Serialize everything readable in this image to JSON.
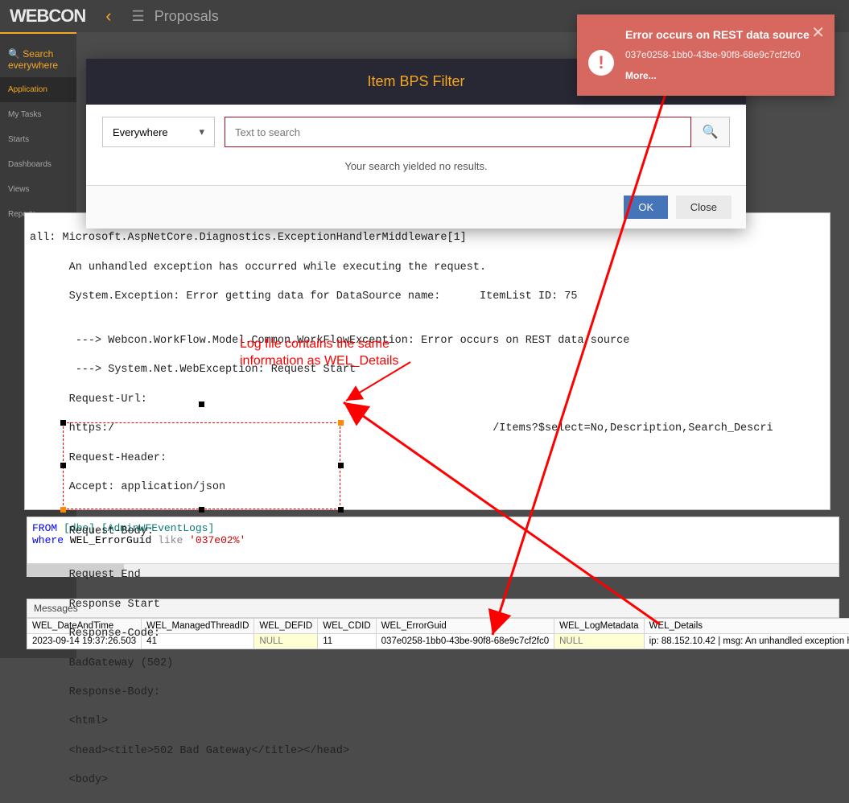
{
  "header": {
    "logo": "WEBCON",
    "page_title": "Proposals"
  },
  "sidebar": {
    "search_label": "Search everywhere",
    "items": [
      {
        "label": "Application"
      },
      {
        "label": "My Tasks"
      },
      {
        "label": "Starts"
      },
      {
        "label": "Dashboards"
      },
      {
        "label": "Views"
      },
      {
        "label": "Reports"
      }
    ]
  },
  "modal": {
    "title": "Item BPS Filter",
    "scope": "Everywhere",
    "search_placeholder": "Text to search",
    "no_results": "Your search yielded no results.",
    "ok": "OK",
    "close": "Close"
  },
  "toast": {
    "title": "Error occurs on REST data source",
    "sub": "037e0258-1bb0-43be-90f8-68e9c7cf2fc0",
    "more": "More..."
  },
  "annotation": {
    "text": "Log file contains the same\ninformation as WEL_Details"
  },
  "log": {
    "lines": [
      "all: Microsoft.AspNetCore.Diagnostics.ExceptionHandlerMiddleware[1]",
      "      An unhandled exception has occurred while executing the request.",
      "      System.Exception: Error getting data for DataSource name:      ItemList ID: 75",
      "",
      "       ---> Webcon.WorkFlow.Model.Common.WorkFlowException: Error occurs on REST data source",
      "       ---> System.Net.WebException: Request Start",
      "      Request-Url:",
      "      https:/                                                          /Items?$select=No,Description,Search_Descri",
      "      Request-Header:",
      "      Accept: application/json",
      "",
      "      Request-Body:",
      "",
      "      Request End",
      "      Response Start",
      "      Response-Code:",
      "      BadGateway (502)",
      "      Response-Body:",
      "      <html>",
      "      <head><title>502 Bad Gateway</title></head>",
      "      <body>"
    ]
  },
  "sql": {
    "line1": {
      "from": "FROM",
      "schema": "[dbo]",
      "dot": ".",
      "table": "[AdminWFEventLogs]"
    },
    "line2": {
      "where": "where",
      "col": "WEL_ErrorGuid",
      "like": "like",
      "val": "'037e02%'"
    }
  },
  "results": {
    "tab": "Messages",
    "columns": [
      "WEL_DateAndTime",
      "WEL_ManagedThreadID",
      "WEL_DEFID",
      "WEL_CDID",
      "WEL_ErrorGuid",
      "WEL_LogMetadata",
      "WEL_Details"
    ],
    "row": {
      "WEL_DateAndTime": "2023-09-14 19:37:26.503",
      "WEL_ManagedThreadID": "41",
      "WEL_DEFID": "NULL",
      "WEL_CDID": "11",
      "WEL_ErrorGuid": "037e0258-1bb0-43be-90f8-68e9c7cf2fc0",
      "WEL_LogMetadata": "NULL",
      "WEL_Details": "ip: 88.152.10.42 | msg: An unhandled exception h..."
    }
  }
}
